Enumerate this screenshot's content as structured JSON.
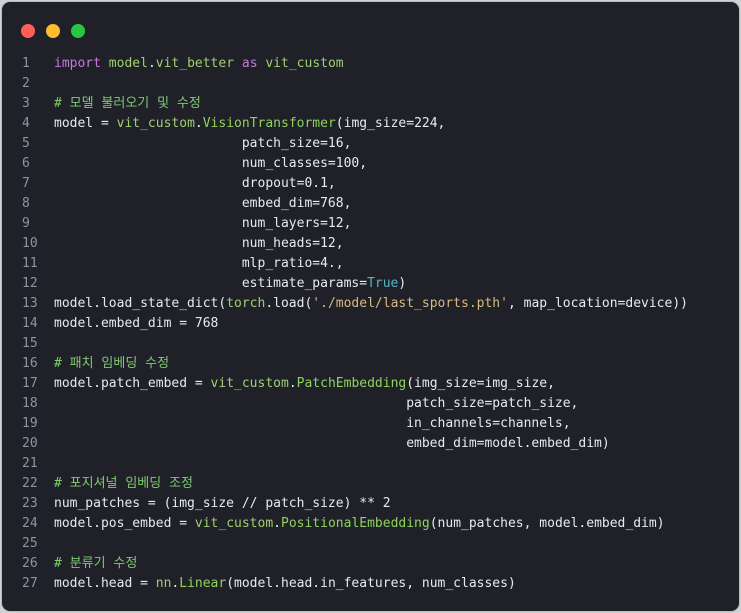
{
  "window": {
    "buttons": [
      "close",
      "minimize",
      "maximize"
    ]
  },
  "code_lines": [
    {
      "n": "1",
      "tokens": [
        [
          "kw",
          "import"
        ],
        [
          "plain",
          " "
        ],
        [
          "mod",
          "model"
        ],
        [
          "plain",
          "."
        ],
        [
          "mod",
          "vit_better"
        ],
        [
          "plain",
          " "
        ],
        [
          "kw",
          "as"
        ],
        [
          "plain",
          " "
        ],
        [
          "mod",
          "vit_custom"
        ]
      ]
    },
    {
      "n": "2",
      "tokens": []
    },
    {
      "n": "3",
      "tokens": [
        [
          "cm",
          "# 모델 불러오기 및 수정"
        ]
      ]
    },
    {
      "n": "4",
      "tokens": [
        [
          "plain",
          "model = "
        ],
        [
          "mod",
          "vit_custom"
        ],
        [
          "plain",
          "."
        ],
        [
          "cls",
          "VisionTransformer"
        ],
        [
          "plain",
          "(img_size=224,"
        ]
      ]
    },
    {
      "n": "5",
      "tokens": [
        [
          "plain",
          "                        patch_size=16,"
        ]
      ]
    },
    {
      "n": "6",
      "tokens": [
        [
          "plain",
          "                        num_classes=100,"
        ]
      ]
    },
    {
      "n": "7",
      "tokens": [
        [
          "plain",
          "                        dropout=0.1,"
        ]
      ]
    },
    {
      "n": "8",
      "tokens": [
        [
          "plain",
          "                        embed_dim=768,"
        ]
      ]
    },
    {
      "n": "9",
      "tokens": [
        [
          "plain",
          "                        num_layers=12,"
        ]
      ]
    },
    {
      "n": "10",
      "tokens": [
        [
          "plain",
          "                        num_heads=12,"
        ]
      ]
    },
    {
      "n": "11",
      "tokens": [
        [
          "plain",
          "                        mlp_ratio=4.,"
        ]
      ]
    },
    {
      "n": "12",
      "tokens": [
        [
          "plain",
          "                        estimate_params="
        ],
        [
          "const",
          "True"
        ],
        [
          "plain",
          ")"
        ]
      ]
    },
    {
      "n": "13",
      "tokens": [
        [
          "plain",
          "model.load_state_dict("
        ],
        [
          "mod",
          "torch"
        ],
        [
          "plain",
          ".load("
        ],
        [
          "str",
          "'./model/last_sports.pth'"
        ],
        [
          "plain",
          ", map_location=device))"
        ]
      ]
    },
    {
      "n": "14",
      "tokens": [
        [
          "plain",
          "model.embed_dim = 768"
        ]
      ]
    },
    {
      "n": "15",
      "tokens": []
    },
    {
      "n": "16",
      "tokens": [
        [
          "cm",
          "# 패치 임베딩 수정"
        ]
      ]
    },
    {
      "n": "17",
      "tokens": [
        [
          "plain",
          "model.patch_embed = "
        ],
        [
          "mod",
          "vit_custom"
        ],
        [
          "plain",
          "."
        ],
        [
          "cls",
          "PatchEmbedding"
        ],
        [
          "plain",
          "(img_size=img_size,"
        ]
      ]
    },
    {
      "n": "18",
      "tokens": [
        [
          "plain",
          "                                             patch_size=patch_size,"
        ]
      ]
    },
    {
      "n": "19",
      "tokens": [
        [
          "plain",
          "                                             in_channels=channels,"
        ]
      ]
    },
    {
      "n": "20",
      "tokens": [
        [
          "plain",
          "                                             embed_dim=model.embed_dim)"
        ]
      ]
    },
    {
      "n": "21",
      "tokens": []
    },
    {
      "n": "22",
      "tokens": [
        [
          "cm",
          "# 포지셔널 임베딩 조정"
        ]
      ]
    },
    {
      "n": "23",
      "tokens": [
        [
          "plain",
          "num_patches = (img_size // patch_size) ** 2"
        ]
      ]
    },
    {
      "n": "24",
      "tokens": [
        [
          "plain",
          "model.pos_embed = "
        ],
        [
          "mod",
          "vit_custom"
        ],
        [
          "plain",
          "."
        ],
        [
          "cls",
          "PositionalEmbedding"
        ],
        [
          "plain",
          "(num_patches, model.embed_dim)"
        ]
      ]
    },
    {
      "n": "25",
      "tokens": []
    },
    {
      "n": "26",
      "tokens": [
        [
          "cm",
          "# 분류기 수정"
        ]
      ]
    },
    {
      "n": "27",
      "tokens": [
        [
          "plain",
          "model.head = "
        ],
        [
          "mod",
          "nn"
        ],
        [
          "plain",
          "."
        ],
        [
          "cls",
          "Linear"
        ],
        [
          "plain",
          "(model.head.in_features, num_classes)"
        ]
      ]
    }
  ],
  "colors": {
    "background": "#1f2028",
    "keyword": "#c778dd",
    "module": "#9ed072",
    "comment": "#7fcb70",
    "string": "#d7ba7d",
    "constant": "#56b6c2"
  }
}
